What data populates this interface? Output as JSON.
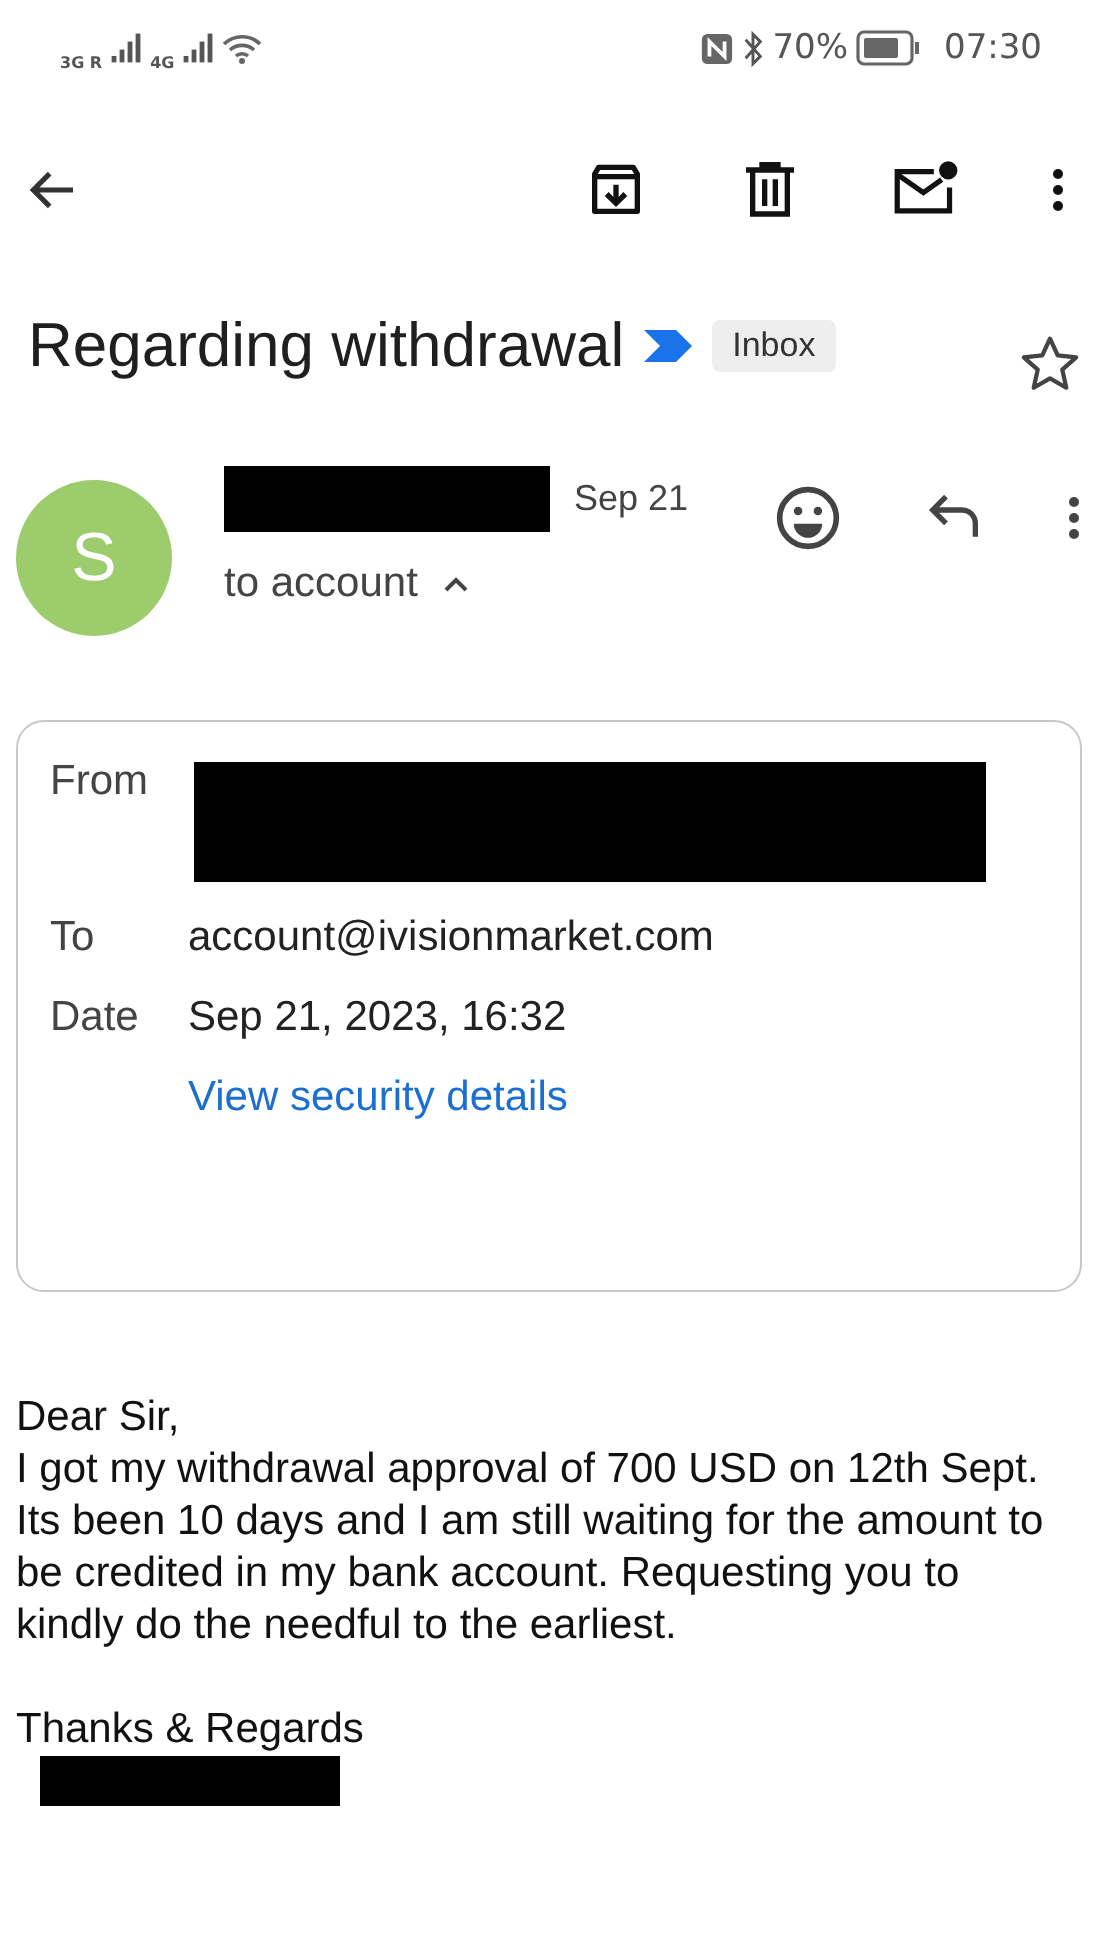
{
  "status_bar": {
    "network_1": "3G R",
    "network_2": "4G",
    "battery": "70%",
    "time": "07:30"
  },
  "subject": {
    "title": "Regarding withdrawal",
    "label": "Inbox",
    "starred": false
  },
  "message": {
    "avatar": "S",
    "date": "Sep 21",
    "recipient": "to account",
    "details_expanded": true
  },
  "details": [
    {
      "kind": "redacted",
      "label": "From"
    },
    {
      "kind": "text",
      "label": "To",
      "value": "account@ivisionmarket.com"
    },
    {
      "kind": "text",
      "label": "Date",
      "value": "Sep 21, 2023, 16:32"
    }
  ],
  "security_link": "View security details",
  "body": [
    {
      "kind": "text",
      "text": "Dear Sir,"
    },
    {
      "kind": "text",
      "text": "I got my withdrawal approval of 700 USD on 12th Sept. Its been 10 days and I am still waiting for the amount to be credited in my bank account. Requesting you to kindly do the needful to the earliest."
    },
    {
      "kind": "gap"
    },
    {
      "kind": "text",
      "text": "Thanks & Regards"
    },
    {
      "kind": "redacted"
    }
  ]
}
